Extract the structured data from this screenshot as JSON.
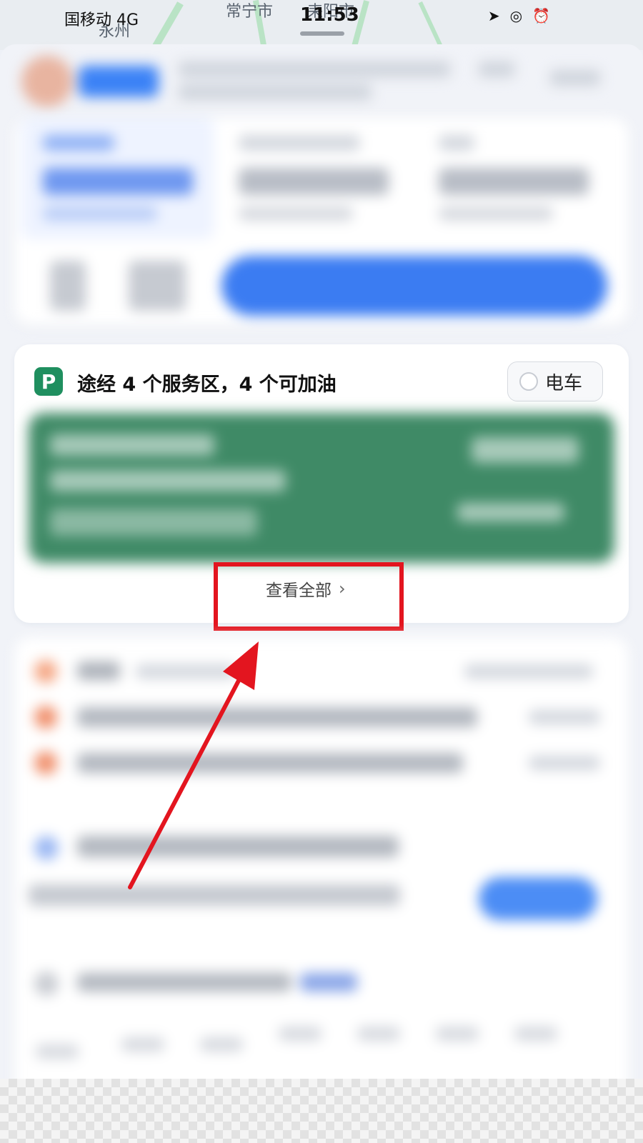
{
  "status_bar": {
    "carrier": "国移动",
    "network": "4G",
    "time": "11:53",
    "map_labels": [
      "永州",
      "常宁市",
      "耒阳市"
    ]
  },
  "service_area": {
    "icon": "P",
    "title": "途经 4 个服务区，4 个可加油",
    "ev_toggle_label": "电车",
    "view_all_label": "查看全部",
    "view_all_chevron": "›"
  },
  "annotation": {
    "highlight_color": "#e3151f",
    "arrow_color": "#e3151f"
  },
  "colors": {
    "service_icon": "#1f8f5f",
    "service_panel": "#3f8a66",
    "go_button": "#3b7cf2"
  }
}
